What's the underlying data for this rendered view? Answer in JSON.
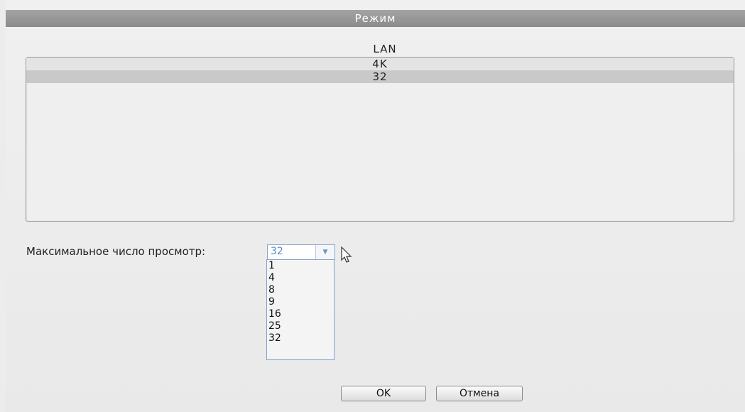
{
  "dialog": {
    "title": "Режим",
    "list": {
      "header": "LAN",
      "rows": [
        "4K",
        "32"
      ]
    },
    "max_view": {
      "label": "Максимальное число просмотр:",
      "selected": "32",
      "options": [
        "1",
        "4",
        "8",
        "9",
        "16",
        "25",
        "32"
      ]
    },
    "buttons": {
      "ok": "OK",
      "cancel": "Отмена"
    }
  }
}
